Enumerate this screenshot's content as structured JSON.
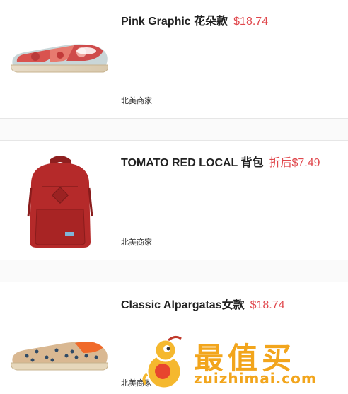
{
  "products": [
    {
      "title": "Pink Graphic 花朵款",
      "price": "$18.74",
      "seller": "北美商家",
      "image": "pink-floral-slip-on-shoe"
    },
    {
      "title": "TOMATO RED LOCAL 背包",
      "price": "折后$7.49",
      "seller": "北美商家",
      "image": "red-backpack"
    },
    {
      "title": "Classic Alpargatas女款",
      "price": "$18.74",
      "seller": "北美商家",
      "image": "tan-anchor-print-slip-on-shoe"
    }
  ],
  "watermark": {
    "brand": "最值买",
    "url": "zuizhimai.com"
  },
  "colors": {
    "price": "#e0474c",
    "watermark": "#f2a51c",
    "divider": "#e6e6e6"
  }
}
